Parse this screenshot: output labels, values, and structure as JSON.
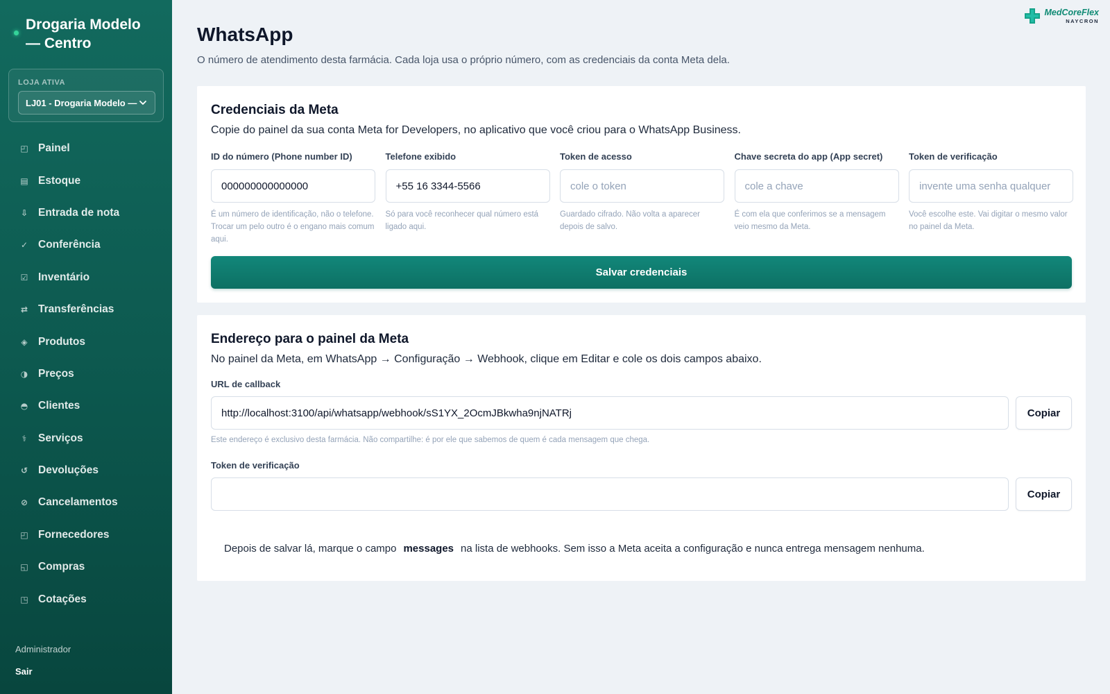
{
  "sidebar": {
    "brand_line1": "Drogaria Modelo",
    "brand_line2": "— Centro",
    "store_label": "LOJA ATIVA",
    "store_value": "LJ01 - Drogaria Modelo —",
    "items": [
      {
        "label": "Painel",
        "icon": "◰"
      },
      {
        "label": "Estoque",
        "icon": "▤"
      },
      {
        "label": "Entrada de nota",
        "icon": "⇩"
      },
      {
        "label": "Conferência",
        "icon": "✓"
      },
      {
        "label": "Inventário",
        "icon": "☑"
      },
      {
        "label": "Transferências",
        "icon": "⇄"
      },
      {
        "label": "Produtos",
        "icon": "◈"
      },
      {
        "label": "Preços",
        "icon": "◑"
      },
      {
        "label": "Clientes",
        "icon": "◓"
      },
      {
        "label": "Serviços",
        "icon": "⚕"
      },
      {
        "label": "Devoluções",
        "icon": "↺"
      },
      {
        "label": "Cancelamentos",
        "icon": "⊘"
      },
      {
        "label": "Fornecedores",
        "icon": "◰"
      },
      {
        "label": "Compras",
        "icon": "◱"
      },
      {
        "label": "Cotações",
        "icon": "◳"
      }
    ],
    "user_role": "Administrador",
    "logout": "Sair"
  },
  "logo": {
    "main": "MedCoreFlex",
    "sub": "NAYCRON"
  },
  "page": {
    "title": "WhatsApp",
    "subtitle": "O número de atendimento desta farmácia. Cada loja usa o próprio número, com as credenciais da conta Meta dela."
  },
  "credentials": {
    "title": "Credenciais da Meta",
    "description": "Copie do painel da sua conta Meta for Developers, no aplicativo que você criou para o WhatsApp Business.",
    "fields": [
      {
        "label": "ID do número (Phone number ID)",
        "value": "000000000000000",
        "placeholder": "",
        "help": "É um número de identificação, não o telefone. Trocar um pelo outro é o engano mais comum aqui."
      },
      {
        "label": "Telefone exibido",
        "value": "+55 16 3344-5566",
        "placeholder": "",
        "help": "Só para você reconhecer qual número está ligado aqui."
      },
      {
        "label": "Token de acesso",
        "value": "",
        "placeholder": "cole o token",
        "help": "Guardado cifrado. Não volta a aparecer depois de salvo."
      },
      {
        "label": "Chave secreta do app (App secret)",
        "value": "",
        "placeholder": "cole a chave",
        "help": "É com ela que conferimos se a mensagem veio mesmo da Meta."
      },
      {
        "label": "Token de verificação",
        "value": "",
        "placeholder": "invente uma senha qualquer",
        "help": "Você escolhe este. Vai digitar o mesmo valor no painel da Meta."
      }
    ],
    "save_label": "Salvar credenciais"
  },
  "webhook": {
    "title": "Endereço para o painel da Meta",
    "description": "No painel da Meta, em WhatsApp → Configuração → Webhook, clique em Editar e cole os dois campos abaixo.",
    "callback_label": "URL de callback",
    "callback_value": "http://localhost:3100/api/whatsapp/webhook/sS1YX_2OcmJBkwha9njNATRj",
    "callback_help": "Este endereço é exclusivo desta farmácia. Não compartilhe: é por ele que sabemos de quem é cada mensagem que chega.",
    "verify_label": "Token de verificação",
    "verify_value": "",
    "copy_label": "Copiar",
    "note_before": "Depois de salvar lá, marque o campo",
    "note_bold": "messages",
    "note_after": "na lista de webhooks. Sem isso a Meta aceita a configuração e nunca entrega mensagem nenhuma."
  },
  "colors": {
    "sidebar": "#0d5a50",
    "accent": "#0f8a74",
    "background": "#eef2f6"
  }
}
